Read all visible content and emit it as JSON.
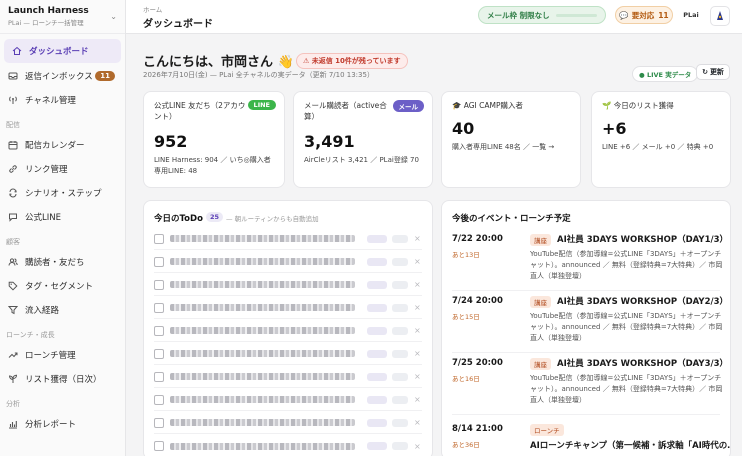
{
  "brand": {
    "title": "Launch Harness",
    "subtitle": "PLai — ローンチ一括管理"
  },
  "sidebar": {
    "items_top": [
      {
        "label": "ダッシュボード",
        "icon": "home-icon",
        "active": true
      },
      {
        "label": "返信インボックス",
        "icon": "inbox-icon",
        "badge": "11"
      },
      {
        "label": "チャネル管理",
        "icon": "antenna-icon"
      }
    ],
    "section_delivery": "配信",
    "items_delivery": [
      {
        "label": "配信カレンダー",
        "icon": "calendar-icon"
      },
      {
        "label": "リンク管理",
        "icon": "link-icon"
      },
      {
        "label": "シナリオ・ステップ",
        "icon": "loop-icon"
      },
      {
        "label": "公式LINE",
        "icon": "chat-icon"
      }
    ],
    "section_customers": "顧客",
    "items_customers": [
      {
        "label": "購読者・友だち",
        "icon": "users-icon"
      },
      {
        "label": "タグ・セグメント",
        "icon": "tag-icon"
      },
      {
        "label": "流入経路",
        "icon": "funnel-icon"
      }
    ],
    "section_launch": "ローンチ・成長",
    "items_launch": [
      {
        "label": "ローンチ管理",
        "icon": "trend-icon"
      },
      {
        "label": "リスト獲得（日次）",
        "icon": "sprout-icon"
      }
    ],
    "section_analysis": "分析",
    "items_analysis": [
      {
        "label": "分析レポート",
        "icon": "chart-icon"
      }
    ]
  },
  "header": {
    "breadcrumb": "ホーム",
    "title": "ダッシュボード",
    "mail_quota": "メール枠 制限なし",
    "needs_reply_label": "要対応",
    "needs_reply_count": "11",
    "org_short": "PLai"
  },
  "greeting": {
    "text": "こんにちは、市岡さん",
    "emoji": "👋",
    "unreplied": "未返信 10件が残っています",
    "subline": "2026年7月10日(金) — PLai 全チャネルの実データ（更新 7/10 13:35）",
    "live_label": "LIVE 実データ",
    "refresh_label": "更新"
  },
  "stats": [
    {
      "label": "公式LINE 友だち（2アカウント）",
      "tag": "LINE",
      "tag_color": "#3bb54a",
      "value": "952",
      "sub1": "LINE Harness: 904 ／ いち◎購入者",
      "sub2": "専用LINE: 48"
    },
    {
      "label": "メール購読者（active合算）",
      "tag": "メール",
      "tag_color": "#6c5fc7",
      "value": "3,491",
      "sub1": "AirCleリスト 3,421 ／ PLai登録 70",
      "sub2": ""
    },
    {
      "label": "AGI CAMP購入者",
      "icon": "graduation-icon",
      "value": "40",
      "sub1": "購入者専用LINE 48名 ／ 一覧 →",
      "sub2": ""
    },
    {
      "label": "今日のリスト獲得",
      "icon": "sprout-icon",
      "value": "+6",
      "sub1": "LINE +6 ／ メール +0 ／ 特典 +0",
      "sub2": ""
    }
  ],
  "todo": {
    "title": "今日のToDo",
    "count": "25",
    "note": "— 朝ルーティンからも自動追加"
  },
  "events": {
    "title": "今後のイベント・ローンチ予定",
    "items": [
      {
        "date": "7/22 20:00",
        "days": "あと13日",
        "tag": "講座",
        "title": "AI社員 3DAYS WORKSHOP（DAY1/3）",
        "desc": "YouTube配信（参加導線=公式LINE「3DAYS」＋オープンチャット）。announced ／ 無料（登録特典=7大特典）／ 市岡直人（単独登壇）"
      },
      {
        "date": "7/24 20:00",
        "days": "あと15日",
        "tag": "講座",
        "title": "AI社員 3DAYS WORKSHOP（DAY2/3）",
        "desc": "YouTube配信（参加導線=公式LINE「3DAYS」＋オープンチャット）。announced ／ 無料（登録特典=7大特典）／ 市岡直人（単独登壇）"
      },
      {
        "date": "7/25 20:00",
        "days": "あと16日",
        "tag": "講座",
        "title": "AI社員 3DAYS WORKSHOP（DAY3/3）",
        "desc": "YouTube配信（参加導線=公式LINE「3DAYS」＋オープンチャット）。announced ／ 無料（登録特典=7大特典）／ 市岡直人（単独登壇）"
      },
      {
        "date": "8/14 21:00",
        "days": "あと36日",
        "tag": "ローンチ",
        "title": "AIローンチキャンプ（第一候補・訴求軸「AI時代の…",
        "desc": ""
      }
    ]
  },
  "colors": {
    "accent": "#5b3fb5",
    "line_green": "#3bb54a",
    "mail_purple": "#6c5fc7",
    "warn_orange": "#c0672a"
  }
}
